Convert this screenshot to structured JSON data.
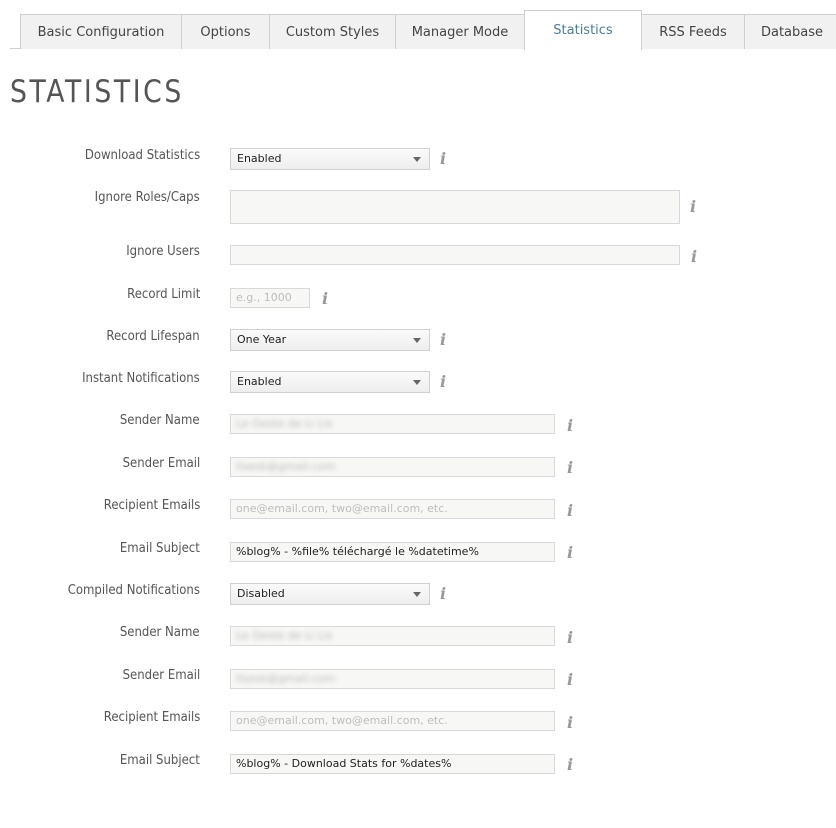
{
  "tabs": [
    {
      "label": "Basic Configuration",
      "active": false
    },
    {
      "label": "Options",
      "active": false
    },
    {
      "label": "Custom Styles",
      "active": false
    },
    {
      "label": "Manager Mode",
      "active": false
    },
    {
      "label": "Statistics",
      "active": true
    },
    {
      "label": "RSS Feeds",
      "active": false
    },
    {
      "label": "Database",
      "active": false
    }
  ],
  "page_title": "STATISTICS",
  "info_glyph": "i",
  "fields": {
    "download_statistics": {
      "label": "Download Statistics",
      "value": "Enabled"
    },
    "ignore_roles": {
      "label": "Ignore Roles/Caps",
      "value": ""
    },
    "ignore_users": {
      "label": "Ignore Users",
      "value": ""
    },
    "record_limit": {
      "label": "Record Limit",
      "placeholder": "e.g., 1000"
    },
    "record_lifespan": {
      "label": "Record Lifespan",
      "value": "One Year"
    },
    "instant_notifications": {
      "label": "Instant Notifications",
      "value": "Enabled",
      "sender_name": {
        "label": "Sender Name",
        "value": "Le Geste de Li Lis"
      },
      "sender_email": {
        "label": "Sender Email",
        "value": "lisesk@gmail.com"
      },
      "recipient_emails": {
        "label": "Recipient Emails",
        "placeholder": "one@email.com, two@email.com, etc."
      },
      "email_subject": {
        "label": "Email Subject",
        "value": "%blog% - %file% téléchargé le  %datetime%"
      }
    },
    "compiled_notifications": {
      "label": "Compiled Notifications",
      "value": "Disabled",
      "sender_name": {
        "label": "Sender Name",
        "value": "Le Geste de Li Lis"
      },
      "sender_email": {
        "label": "Sender Email",
        "value": "lisesk@gmail.com"
      },
      "recipient_emails": {
        "label": "Recipient Emails",
        "placeholder": "one@email.com, two@email.com, etc."
      },
      "email_subject": {
        "label": "Email Subject",
        "value": "%blog% - Download Stats for %dates%"
      }
    }
  }
}
